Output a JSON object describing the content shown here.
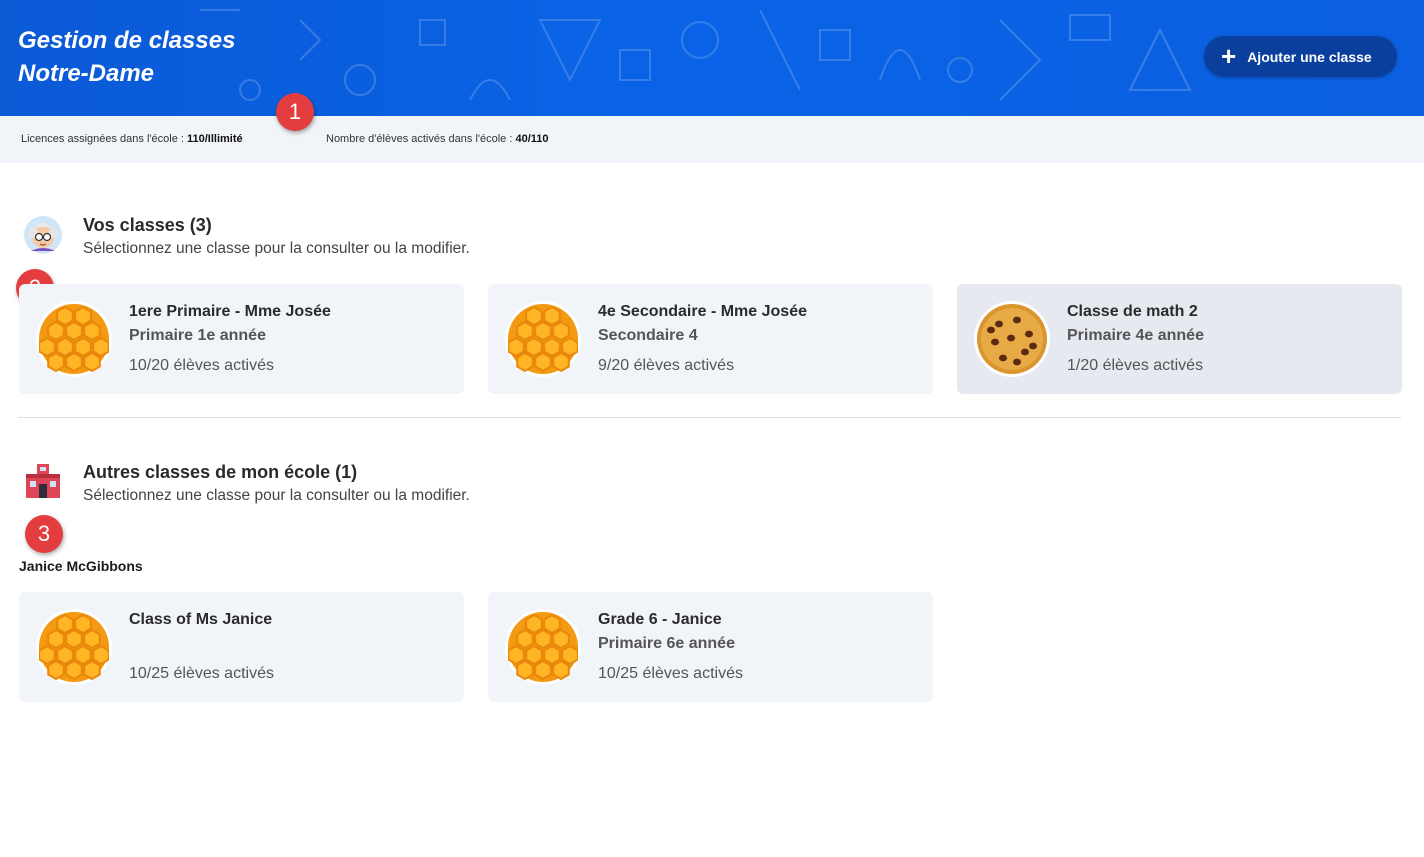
{
  "header": {
    "title_line1": "Gestion de classes",
    "title_line2": "Notre-Dame",
    "add_button_label": "Ajouter une classe",
    "add_button_icon": "plus-icon"
  },
  "stats": {
    "licences_label": "Licences assignées dans l'école : ",
    "licences_value": "110/Illimité",
    "students_label": "Nombre d'élèves activés dans l'école : ",
    "students_value": "40/110"
  },
  "markers": [
    "1",
    "2",
    "3"
  ],
  "my_classes": {
    "icon": "teacher-avatar-icon",
    "title": "Vos classes (3)",
    "subtitle": "Sélectionnez une classe pour la consulter ou la modifier.",
    "cards": [
      {
        "title": "1ere Primaire - Mme Josée",
        "grade": "Primaire 1e année",
        "count": "10/20 élèves activés",
        "avatar": "honeycomb-icon"
      },
      {
        "title": "4e Secondaire - Mme Josée",
        "grade": "Secondaire 4",
        "count": "9/20 élèves activés",
        "avatar": "honeycomb-icon"
      },
      {
        "title": "Classe de math 2",
        "grade": "Primaire 4e année",
        "count": "1/20 élèves activés",
        "avatar": "cookie-icon"
      }
    ]
  },
  "other_classes": {
    "icon": "school-building-icon",
    "title": "Autres classes de mon école (1)",
    "subtitle": "Sélectionnez une classe pour la consulter ou la modifier.",
    "teacher": "Janice McGibbons",
    "cards": [
      {
        "title": "Class of Ms Janice",
        "grade": "",
        "count": "10/25 élèves activés",
        "avatar": "honeycomb-icon"
      },
      {
        "title": "Grade 6 - Janice",
        "grade": "Primaire 6e année",
        "count": "10/25 élèves activés",
        "avatar": "honeycomb-icon"
      }
    ]
  },
  "colors": {
    "header_blue": "#0a63e6",
    "button_navy": "#0a3f9e",
    "marker_red": "#e33d3f",
    "card_bg": "#f1f4f8",
    "honey": "#f7a81b"
  }
}
